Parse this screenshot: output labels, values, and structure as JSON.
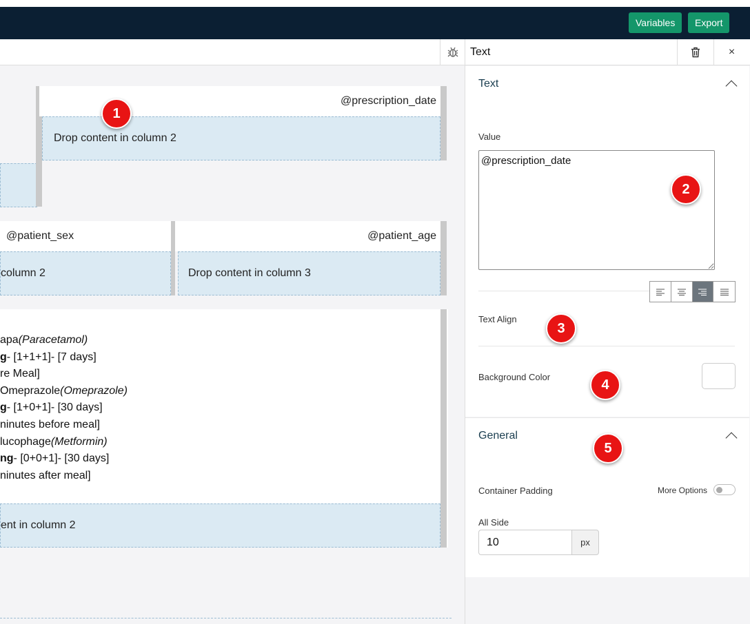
{
  "topbar": {
    "variables_label": "Variables",
    "export_label": "Export"
  },
  "canvas": {
    "row1": {
      "text": "@prescription_date",
      "dropzone": "Drop content in column 2"
    },
    "row2": {
      "col1_text": "@patient_sex",
      "col1_dropzone": "column 2",
      "col2_text": "@patient_age",
      "col2_dropzone": "Drop content in column 3"
    },
    "rx_lines": [
      {
        "a": "apa",
        "b": "(Paracetamol)",
        "style": "drug"
      },
      {
        "a": "g",
        "b": "- [1+1+1]- [7 days]",
        "style": "dose"
      },
      {
        "a": "",
        "b": "re Meal]",
        "style": "note"
      },
      {
        "a": "Omeprazole",
        "b": "(Omeprazole)",
        "style": "drug"
      },
      {
        "a": "g",
        "b": "- [1+0+1]- [30 days]",
        "style": "dose"
      },
      {
        "a": "",
        "b": "ninutes before meal]",
        "style": "note"
      },
      {
        "a": "lucophage",
        "b": "(Metformin)",
        "style": "drug"
      },
      {
        "a": "ng",
        "b": "- [0+0+1]- [30 days]",
        "style": "dose"
      },
      {
        "a": "",
        "b": "ninutes after meal]",
        "style": "note"
      }
    ],
    "row3_dropzone": "ent in column 2"
  },
  "badges": [
    "1",
    "2",
    "3",
    "4",
    "5"
  ],
  "panel": {
    "title": "Text",
    "text_section": {
      "title": "Text",
      "value_label": "Value",
      "value": "@prescription_date",
      "align_label": "Text Align",
      "align_selected": "right",
      "bg_label": "Background Color",
      "bg_value": "#ffffff"
    },
    "general_section": {
      "title": "General",
      "padding_label": "Container Padding",
      "more_options_label": "More Options",
      "all_side_label": "All Side",
      "all_side_value": "10",
      "unit": "px"
    }
  },
  "colors": {
    "topbar": "#0b1f33",
    "button_green": "#14966a",
    "dropzone": "#dbeaf3",
    "badge": "#e81414"
  }
}
